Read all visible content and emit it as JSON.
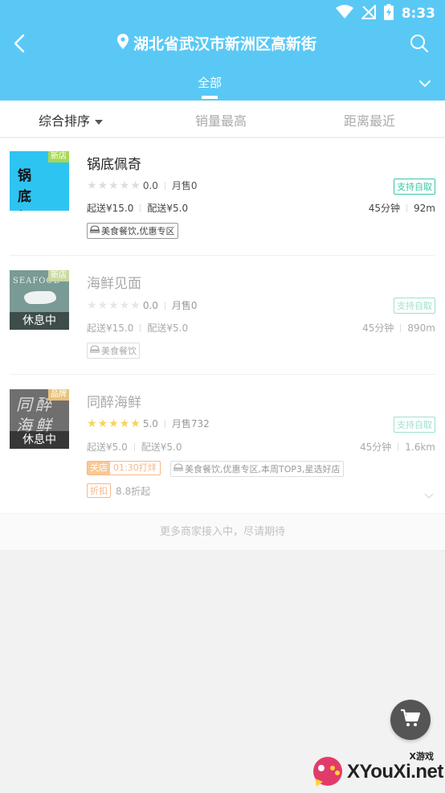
{
  "status_bar": {
    "time": "8:33",
    "icons": [
      "wifi-icon",
      "no-signal-icon",
      "battery-charging-icon"
    ]
  },
  "header": {
    "location": "湖北省武汉市新洲区高新街",
    "category_tab": "全部",
    "colors": {
      "header_bg": "#5ac8f5"
    }
  },
  "sort": {
    "items": [
      "综合排序",
      "销量最高",
      "距离最近"
    ]
  },
  "shops": [
    {
      "name": "锅底佩奇",
      "badge": "新店",
      "thumb_text": "锅 底\n佩 奇",
      "rating": "0.0",
      "stars": 0,
      "monthly_sales": "月售0",
      "pickup": "支持自取",
      "min_order": "起送¥15.0",
      "delivery_fee": "配送¥5.0",
      "time": "45分钟",
      "distance": "92m",
      "tag": "美食餐饮,优惠专区",
      "resting": false
    },
    {
      "name": "海鲜见面",
      "badge": "新店",
      "thumb_text": "SEAFOOD",
      "rest_label": "休息中",
      "rating": "0.0",
      "stars": 0,
      "monthly_sales": "月售0",
      "pickup": "支持自取",
      "min_order": "起送¥15.0",
      "delivery_fee": "配送¥5.0",
      "time": "45分钟",
      "distance": "890m",
      "tag": "美食餐饮",
      "resting": true
    },
    {
      "name": "同醉海鲜",
      "badge": "品牌",
      "thumb_text": "同醉\n海鲜",
      "rest_label": "休息中",
      "rating": "5.0",
      "stars": 5,
      "monthly_sales": "月售732",
      "pickup": "支持自取",
      "min_order": "起送¥5.0",
      "delivery_fee": "配送¥5.0",
      "time": "45分钟",
      "distance": "1.6km",
      "promo": {
        "label": "关店",
        "value": "01:30打烊"
      },
      "tag": "美食餐饮,优惠专区,本周TOP3,星选好店",
      "discount": {
        "label": "折扣",
        "value": "8.8折起"
      },
      "resting": true
    }
  ],
  "footer_note": "更多商家接入中，尽请期待",
  "watermark": {
    "small": "X游戏",
    "main": "XYouXi.net"
  }
}
